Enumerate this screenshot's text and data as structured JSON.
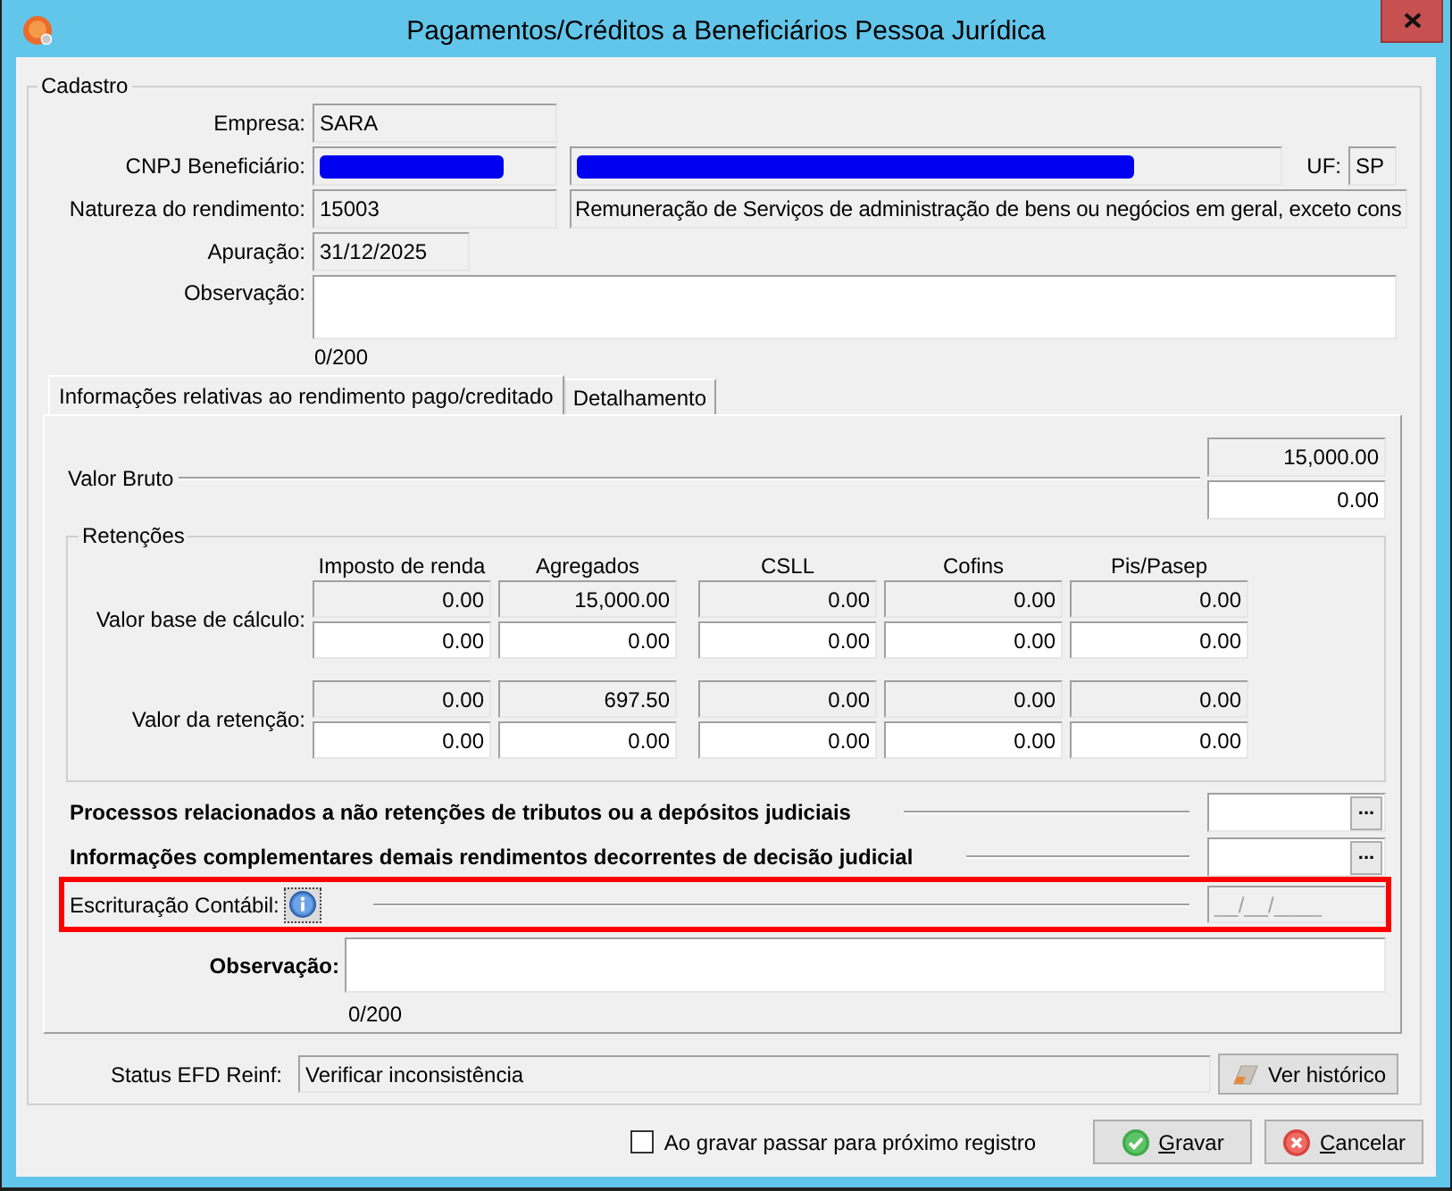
{
  "window": {
    "title": "Pagamentos/Créditos a Beneficiários Pessoa Jurídica"
  },
  "cadastro": {
    "legend": "Cadastro",
    "empresa": {
      "label": "Empresa:",
      "value": "SARA"
    },
    "cnpj": {
      "label": "CNPJ Beneficiário:",
      "number": {
        "redacted": true
      },
      "name": {
        "redacted": true
      },
      "uf_label": "UF:",
      "uf": "SP"
    },
    "natureza": {
      "label": "Natureza do rendimento:",
      "code": "15003",
      "description": "Remuneração de Serviços de administração de bens ou negócios em geral, exceto cons"
    },
    "apuracao": {
      "label": "Apuração:",
      "value": "31/12/2025"
    },
    "observacao": {
      "label": "Observação:",
      "counter": "0/200"
    }
  },
  "tabs": [
    {
      "label": "Informações relativas ao rendimento pago/creditado",
      "selected": true
    },
    {
      "label": "Detalhamento",
      "selected": false
    }
  ],
  "valor_bruto": {
    "label": "Valor Bruto",
    "computed": "15,000.00",
    "value": "0.00"
  },
  "retencoes": {
    "legend": "Retenções",
    "columns": [
      "Imposto de renda",
      "Agregados",
      "CSLL",
      "Cofins",
      "Pis/Pasep"
    ],
    "rows": [
      {
        "label": "Valor base de cálculo:",
        "computed": [
          "0.00",
          "15,000.00",
          "0.00",
          "0.00",
          "0.00"
        ],
        "values": [
          "0.00",
          "0.00",
          "0.00",
          "0.00",
          "0.00"
        ]
      },
      {
        "label": "Valor da retenção:",
        "computed": [
          "0.00",
          "697.50",
          "0.00",
          "0.00",
          "0.00"
        ],
        "values": [
          "0.00",
          "0.00",
          "0.00",
          "0.00",
          "0.00"
        ]
      }
    ]
  },
  "lookups": [
    {
      "label": "Processos relacionados a não retenções de tributos ou a depósitos judiciais",
      "button": "..."
    },
    {
      "label": "Informações complementares demais rendimentos decorrentes de decisão judicial",
      "button": "..."
    }
  ],
  "escrituracao": {
    "label": "Escrituração Contábil:",
    "date": "__/__/____",
    "disabled": true,
    "highlighted": true
  },
  "observacao_rendimento": {
    "label": "Observação:",
    "counter": "0/200"
  },
  "status": {
    "label": "Status EFD Reinf:",
    "value": "Verificar inconsistência",
    "button": "Ver histórico"
  },
  "footer": {
    "next_record": {
      "label": "Ao gravar passar para próximo registro",
      "checked": false
    },
    "buttons": [
      {
        "kind": "save",
        "label": "Gravar"
      },
      {
        "kind": "cancel",
        "label": "Cancelar"
      }
    ]
  }
}
